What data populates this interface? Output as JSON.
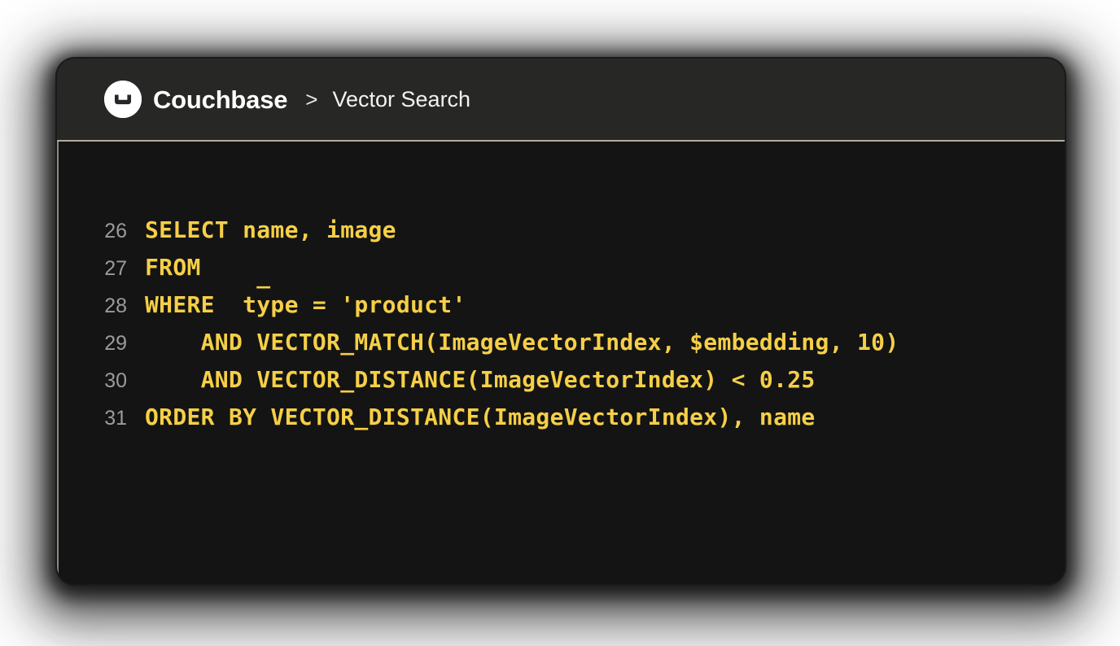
{
  "window": {
    "header": {
      "logo_icon": "couchbase-logo-icon",
      "brand": "Couchbase",
      "separator": ">",
      "page": "Vector Search"
    },
    "editor": {
      "lines": [
        {
          "number": "26",
          "text": "SELECT name, image"
        },
        {
          "number": "27",
          "text": "FROM",
          "caret": "_"
        },
        {
          "number": "28",
          "text": "WHERE  type = 'product'"
        },
        {
          "number": "29",
          "text": "    AND VECTOR_MATCH(ImageVectorIndex, $embedding, 10)"
        },
        {
          "number": "30",
          "text": "    AND VECTOR_DISTANCE(ImageVectorIndex) < 0.25"
        },
        {
          "number": "31",
          "text": "ORDER BY VECTOR_DISTANCE(ImageVectorIndex), name"
        }
      ]
    }
  },
  "colors": {
    "page_background": "#ffffff",
    "titlebar_background": "#272726",
    "code_background": "#141414",
    "divider": "#b3ab9d",
    "code_text": "#f5cf47",
    "gutter_text": "#9b9b9b",
    "brand_text": "#ffffff"
  }
}
